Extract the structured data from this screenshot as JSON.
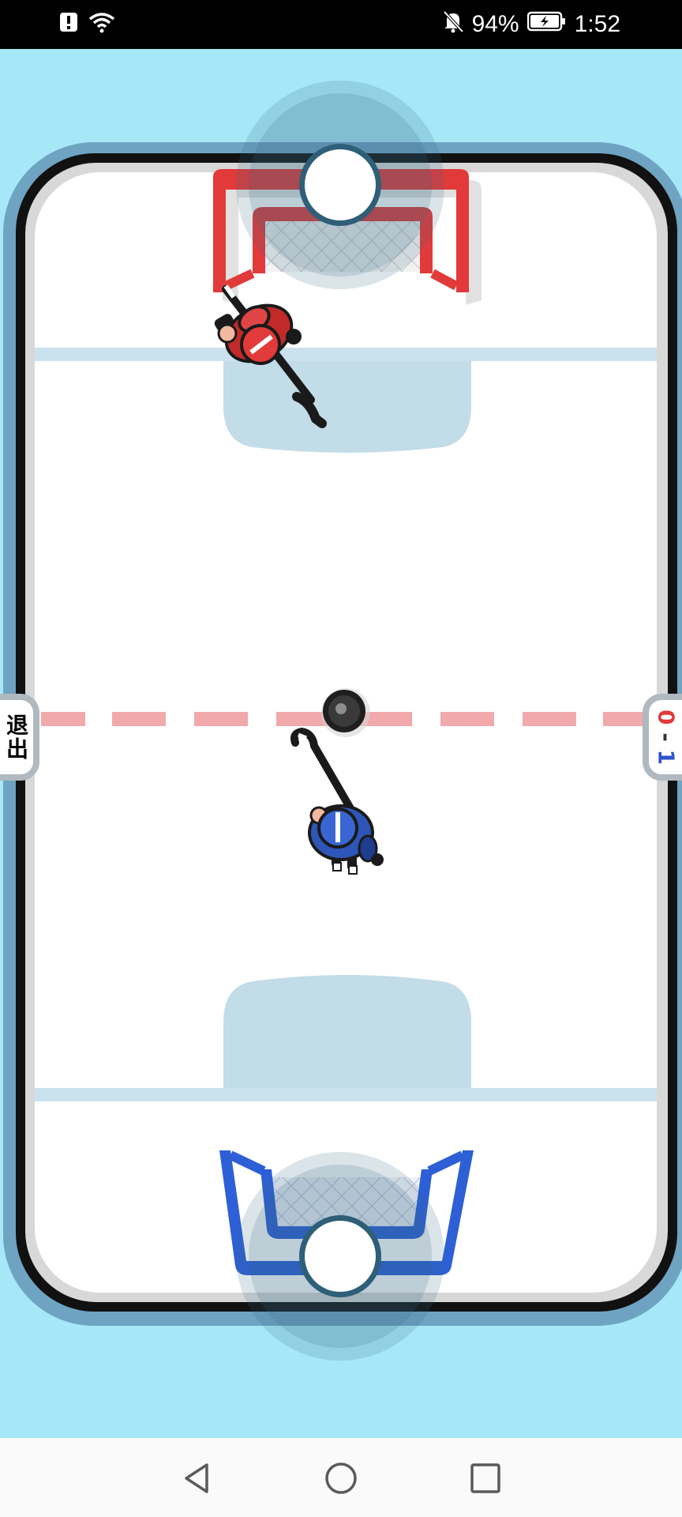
{
  "status_bar": {
    "battery_percent": "94%",
    "time": "1:52",
    "icons": [
      "alert-icon",
      "wifi-icon",
      "bell-off-icon",
      "battery-charging-icon"
    ]
  },
  "game": {
    "exit_label": "退出",
    "score": {
      "red": "0",
      "separator": "-",
      "blue": "1"
    },
    "colors": {
      "ice_background": "#a6e8f7",
      "rink_border": "#111111",
      "red_team": "#e23a3a",
      "blue_team": "#2d5fd6",
      "zone": "#c2dce8",
      "center_line": "#f1a9ab",
      "puck": "#2b2b2b"
    }
  },
  "nav_bar": {
    "icons": [
      "back-icon",
      "home-icon",
      "recents-icon"
    ]
  }
}
